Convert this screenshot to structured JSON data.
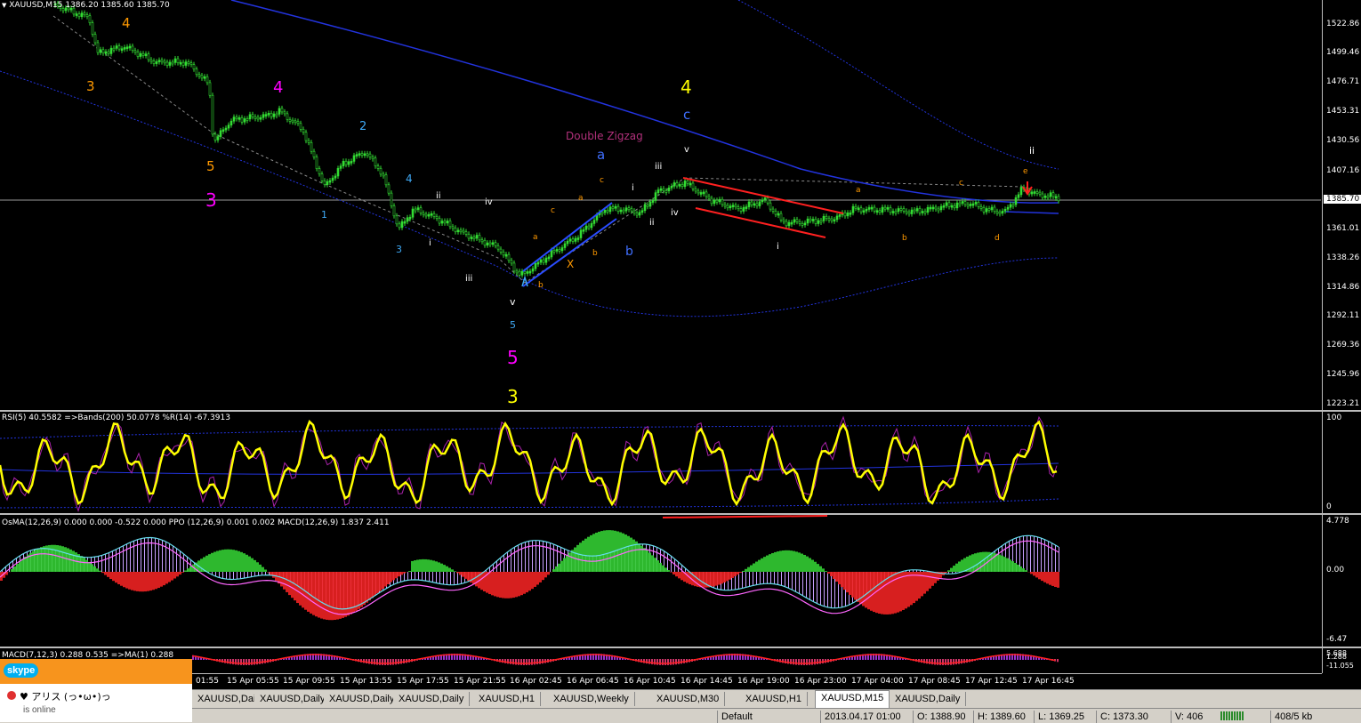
{
  "main_chart": {
    "header": "XAUUSD,M15  1386.20 1385.60 1385.70",
    "header_open_shown": "1386.20",
    "price_ticks": [
      "1522.86",
      "1499.46",
      "1476.71",
      "1453.31",
      "1430.56",
      "1407.16",
      "1361.01",
      "1338.26",
      "1314.86",
      "1292.11",
      "1269.36",
      "1245.96",
      "1223.21"
    ],
    "current_price": "1385.70",
    "wave_labels": [
      {
        "t": "4",
        "c": "#ff9900"
      },
      {
        "t": "3",
        "c": "#ff9900"
      },
      {
        "t": "4",
        "c": "#ff00ff"
      },
      {
        "t": "5",
        "c": "#ff9900"
      },
      {
        "t": "3",
        "c": "#ff00ff"
      },
      {
        "t": "2",
        "c": "#3fa9f5"
      },
      {
        "t": "4",
        "c": "#3fa9f5"
      },
      {
        "t": "1",
        "c": "#3fa9f5"
      },
      {
        "t": "3",
        "c": "#3fa9f5"
      },
      {
        "t": "ii",
        "c": "#ffffff"
      },
      {
        "t": "i",
        "c": "#ffffff"
      },
      {
        "t": "iv",
        "c": "#ffffff"
      },
      {
        "t": "iii",
        "c": "#ffffff"
      },
      {
        "t": "v",
        "c": "#ffffff"
      },
      {
        "t": "5",
        "c": "#3fa9f5"
      },
      {
        "t": "5",
        "c": "#ff00ff"
      },
      {
        "t": "3",
        "c": "#ffff00"
      },
      {
        "t": "a",
        "c": "#ff9900"
      },
      {
        "t": "b",
        "c": "#ff9900"
      },
      {
        "t": "c",
        "c": "#ff9900"
      },
      {
        "t": "a",
        "c": "#ff9900"
      },
      {
        "t": "X",
        "c": "#ff9900"
      },
      {
        "t": "b",
        "c": "#ff9900"
      },
      {
        "t": "c",
        "c": "#ff9900"
      },
      {
        "t": "a",
        "c": "#3f6fff"
      },
      {
        "t": "b",
        "c": "#3f6fff"
      },
      {
        "t": "Double Zigzag",
        "c": "#b0307a"
      },
      {
        "t": "4",
        "c": "#ffff00"
      },
      {
        "t": "c",
        "c": "#3f6fff"
      },
      {
        "t": "i",
        "c": "#ffffff"
      },
      {
        "t": "iii",
        "c": "#ffffff"
      },
      {
        "t": "ii",
        "c": "#ffffff"
      },
      {
        "t": "iv",
        "c": "#ffffff"
      },
      {
        "t": "v",
        "c": "#ffffff"
      },
      {
        "t": "i",
        "c": "#ffffff"
      },
      {
        "t": "a",
        "c": "#ff9900"
      },
      {
        "t": "b",
        "c": "#ff9900"
      },
      {
        "t": "c",
        "c": "#ff9900"
      },
      {
        "t": "d",
        "c": "#ff9900"
      },
      {
        "t": "e",
        "c": "#ff9900"
      },
      {
        "t": "ii",
        "c": "#ffffff"
      }
    ]
  },
  "rsi_pane": {
    "header": "RSI(5) 40.5582  =>Bands(200) 50.0778  %R(14) -67.3913",
    "ticks": [
      "100",
      "0"
    ]
  },
  "osma_pane": {
    "header": "OsMA(12,26,9) 0.000 0.000 -0.522 0.000  PPO (12,26,9) 0.001 0.002  MACD(12,26,9) 1.837 2.411",
    "ticks": [
      "4.778",
      "0.00",
      "-6.47"
    ]
  },
  "macd_pane": {
    "header": "MACD(7,12,3) 0.288 0.535  =>MA(1) 0.288",
    "ticks": [
      "5.688",
      "1.288",
      "-11.055"
    ]
  },
  "time_labels": [
    "01:55",
    "15 Apr 05:55",
    "15 Apr 09:55",
    "15 Apr 13:55",
    "15 Apr 17:55",
    "15 Apr 21:55",
    "16 Apr 02:45",
    "16 Apr 06:45",
    "16 Apr 10:45",
    "16 Apr 14:45",
    "16 Apr 19:00",
    "16 Apr 23:00",
    "17 Apr 04:00",
    "17 Apr 08:45",
    "17 Apr 12:45",
    "17 Apr 16:45"
  ],
  "tabs": [
    {
      "label": "XAUUSD,Daily",
      "active": false
    },
    {
      "label": "XAUUSD,Daily",
      "active": false
    },
    {
      "label": "XAUUSD,Daily",
      "active": false
    },
    {
      "label": "XAUUSD,Daily",
      "active": false
    },
    {
      "label": "XAUUSD,H1",
      "active": false
    },
    {
      "label": "XAUUSD,Weekly",
      "active": false
    },
    {
      "label": "XAUUSD,M30",
      "active": false
    },
    {
      "label": "XAUUSD,H1",
      "active": false
    },
    {
      "label": "XAUUSD,M15",
      "active": true
    },
    {
      "label": "XAUUSD,Daily",
      "active": false
    }
  ],
  "status_bar": {
    "profile": "Default",
    "datetime": "2013.04.17 01:00",
    "open": "O: 1388.90",
    "high": "H: 1389.60",
    "low": "L: 1369.25",
    "close": "C: 1373.30",
    "volume": "V: 406",
    "traffic": "408/5 kb"
  },
  "skype": {
    "logo": "skype",
    "contact": "♥ アリス (っ•ω•)っ",
    "status": "is online"
  },
  "colors": {
    "candle": "#33dd33",
    "ma": "#2233dd",
    "channel_red": "#ff2020",
    "rsi": "#ffff00",
    "wpr": "#aa22aa",
    "osma_pos": "#33cc33",
    "osma_neg": "#ee2222",
    "macd_hist": "#c8a0ff"
  }
}
